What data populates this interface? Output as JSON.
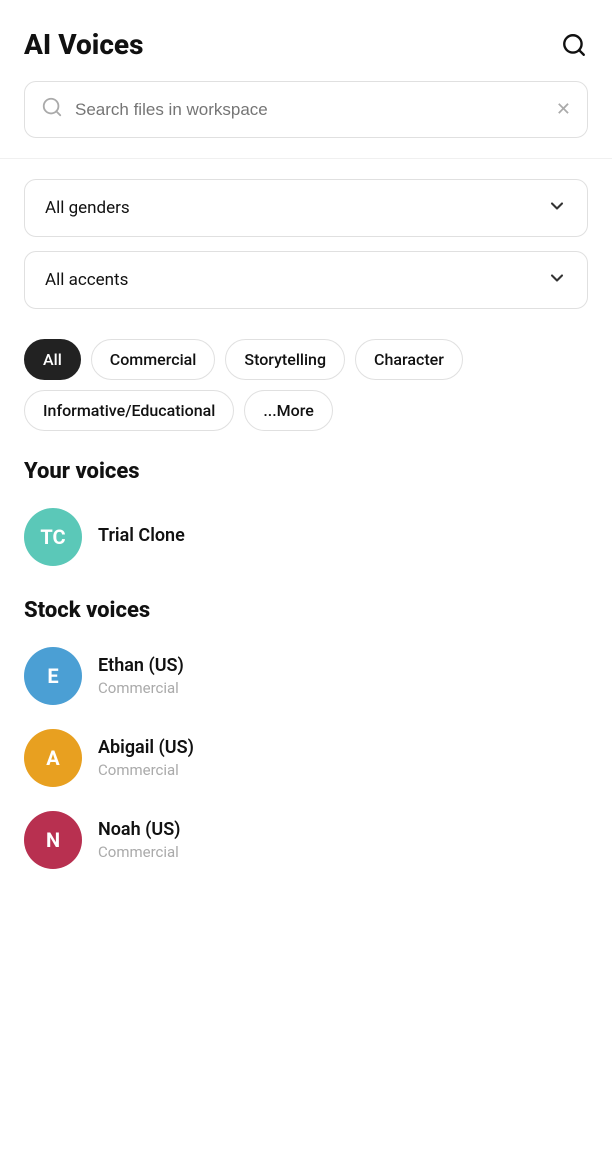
{
  "header": {
    "title": "AI Voices",
    "search_icon": "search"
  },
  "search": {
    "placeholder": "Search files in workspace"
  },
  "filters": {
    "gender_label": "All genders",
    "accent_label": "All accents"
  },
  "tags": [
    {
      "id": "all",
      "label": "All",
      "active": true
    },
    {
      "id": "commercial",
      "label": "Commercial",
      "active": false
    },
    {
      "id": "storytelling",
      "label": "Storytelling",
      "active": false
    },
    {
      "id": "character",
      "label": "Character",
      "active": false
    },
    {
      "id": "informative",
      "label": "Informative/Educational",
      "active": false
    },
    {
      "id": "more",
      "label": "...More",
      "active": false
    }
  ],
  "your_voices_section": {
    "title": "Your voices"
  },
  "your_voices": [
    {
      "initials": "TC",
      "name": "Trial Clone",
      "type": "",
      "color": "tc"
    }
  ],
  "stock_voices_section": {
    "title": "Stock voices"
  },
  "stock_voices": [
    {
      "initials": "E",
      "name": "Ethan (US)",
      "type": "Commercial",
      "color": "e"
    },
    {
      "initials": "A",
      "name": "Abigail (US)",
      "type": "Commercial",
      "color": "a"
    },
    {
      "initials": "N",
      "name": "Noah (US)",
      "type": "Commercial",
      "color": "n"
    }
  ]
}
